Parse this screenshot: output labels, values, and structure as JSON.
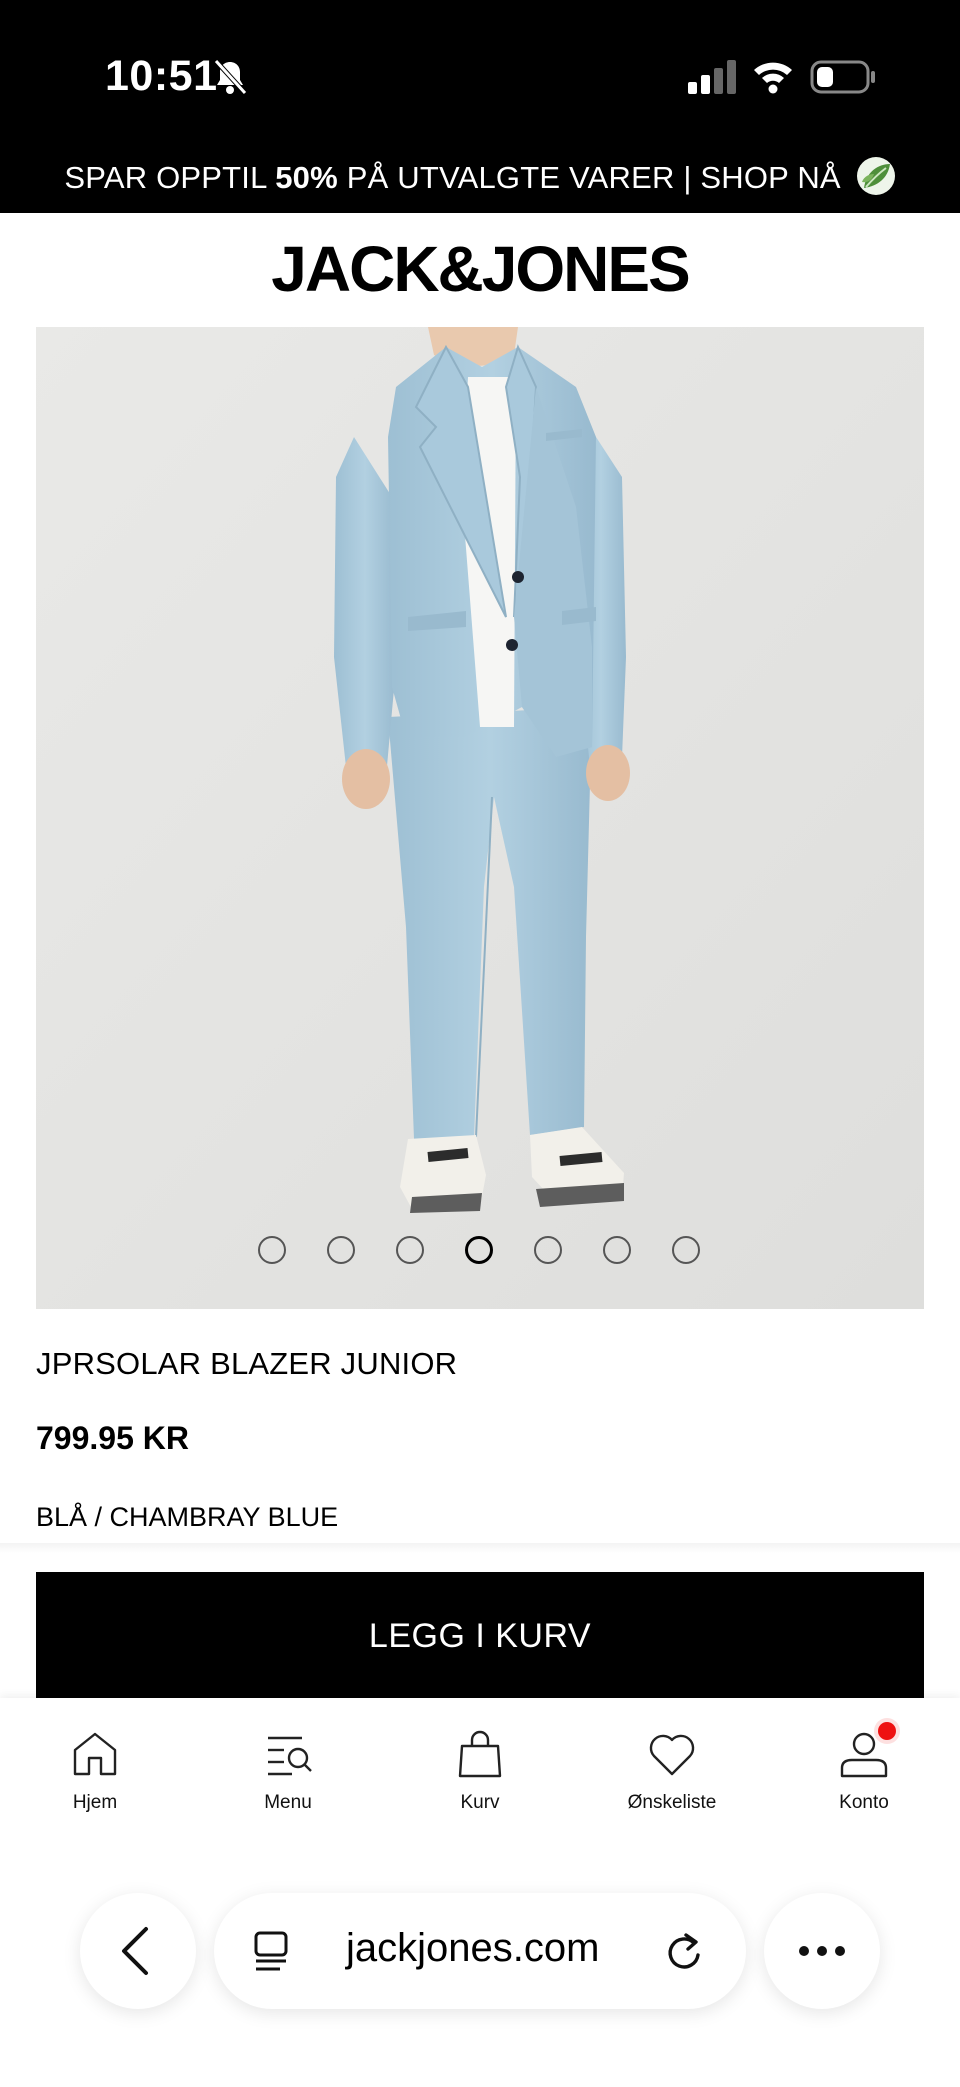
{
  "status_bar": {
    "time": "10:51"
  },
  "promo": {
    "prefix": "SPAR OPPTIL ",
    "highlight": "50%",
    "suffix": " PÅ UTVALGTE VARER | SHOP NÅ"
  },
  "brand": {
    "logo": "JACK&JONES"
  },
  "product": {
    "name": "JPRSOLAR BLAZER JUNIOR",
    "price": "799.95 KR",
    "color": "BLÅ / CHAMBRAY BLUE",
    "image_count": 7,
    "active_image_index": 3,
    "suit_color": "#a7c6d9"
  },
  "actions": {
    "add_to_cart": "LEGG I KURV"
  },
  "bottom_nav": [
    {
      "label": "Hjem",
      "icon": "home-icon"
    },
    {
      "label": "Menu",
      "icon": "menu-search-icon"
    },
    {
      "label": "Kurv",
      "icon": "bag-icon"
    },
    {
      "label": "Ønskeliste",
      "icon": "heart-icon"
    },
    {
      "label": "Konto",
      "icon": "account-icon"
    }
  ],
  "browser": {
    "url": "jackjones.com"
  }
}
